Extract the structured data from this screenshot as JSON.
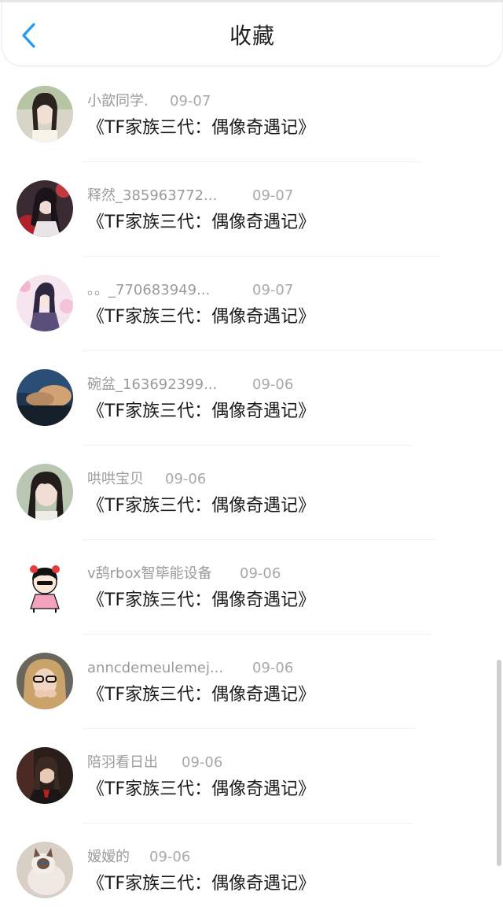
{
  "header": {
    "title": "收藏",
    "back_icon": "chevron-left-icon",
    "accent": "#1f9bf0"
  },
  "items": [
    {
      "name": "小歆同学.",
      "date": "09-07",
      "work": "《TF家族三代：偶像奇遇记》",
      "avatar": "avatar-girl-braids"
    },
    {
      "name": "释然_385963772...",
      "date": "09-07",
      "work": "《TF家族三代：偶像奇遇记》",
      "avatar": "avatar-anime-red"
    },
    {
      "name": "。。_770683949...",
      "date": "09-07",
      "work": "《TF家族三代：偶像奇遇记》",
      "avatar": "avatar-anime-pink"
    },
    {
      "name": "碗盆_163692399...",
      "date": "09-06",
      "work": "《TF家族三代：偶像奇遇记》",
      "avatar": "avatar-clouds"
    },
    {
      "name": "哄哄宝贝",
      "date": "09-06",
      "work": "《TF家族三代：偶像奇遇记》",
      "avatar": "avatar-girl-bangs"
    },
    {
      "name": "v鸹rbox智筚能设备",
      "date": "09-06",
      "work": "《TF家族三代：偶像奇遇记》",
      "avatar": "avatar-cartoon-girl"
    },
    {
      "name": "anncdemeulemej...",
      "date": "09-06",
      "work": "《TF家族三代：偶像奇遇记》",
      "avatar": "avatar-glasses-girl"
    },
    {
      "name": "陪羽看日出",
      "date": "09-06",
      "work": "《TF家族三代：偶像奇遇记》",
      "avatar": "avatar-dark-portrait"
    },
    {
      "name": "嫒嫒的",
      "date": "09-06",
      "work": "《TF家族三代：偶像奇遇记》",
      "avatar": "avatar-cat"
    }
  ]
}
